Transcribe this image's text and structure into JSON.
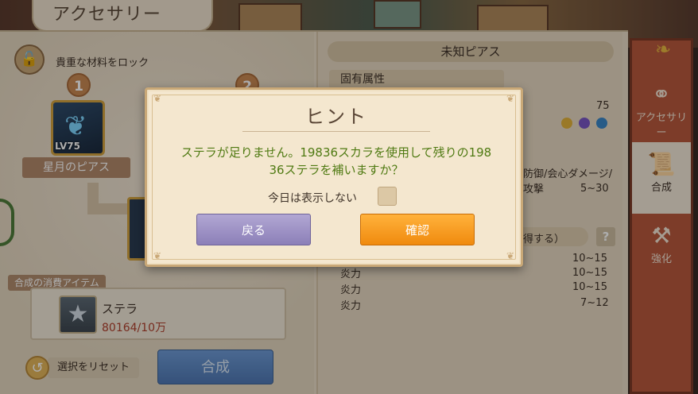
{
  "page_title": "アクセサリー",
  "left": {
    "lock_label": "貴重な材料をロック",
    "step1": "1",
    "step2": "2",
    "item_level": "LV75",
    "item_name": "星月のピアス",
    "consume_header": "合成の消費アイテム",
    "consume_item_name": "ステラ",
    "consume_item_count": "80164/10万",
    "reset_label": "選択をリセット",
    "synth_button": "合成"
  },
  "right": {
    "title": "未知ピアス",
    "attr_header": "固有属性",
    "value_75": "75",
    "attr_sub": "防御/会心ダメージ/攻撃",
    "range1": "5~30",
    "reveal_hint": "得する）",
    "help": "?",
    "rows": [
      {
        "label": "炎力",
        "value": "10~15"
      },
      {
        "label": "炎力",
        "value": "10~15"
      },
      {
        "label": "炎力",
        "value": "10~15"
      },
      {
        "label": "炎力",
        "value": "7~12"
      }
    ],
    "dot_colors": [
      "#e3b33a",
      "#7a56c4",
      "#3a86c8"
    ]
  },
  "nav": {
    "accessory": "アクセサリー",
    "synthesis": "合成",
    "enhance": "強化"
  },
  "dialog": {
    "title": "ヒント",
    "message_line1": "ステラが足りません。19836スカラを使用して残りの198",
    "message_line2": "36ステラを補いますか？",
    "hide_today": "今日は表示しない",
    "back_button": "戻る",
    "confirm_button": "確認"
  }
}
